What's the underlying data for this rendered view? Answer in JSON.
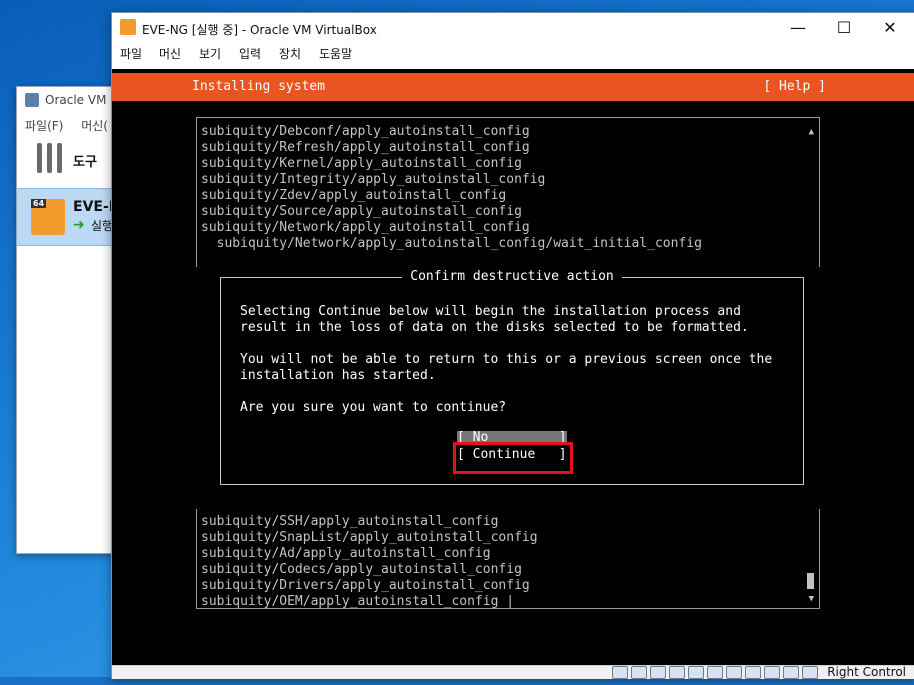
{
  "manager": {
    "title": "Oracle VM",
    "menu": [
      "파일(F)",
      "머신("
    ],
    "tools_label": "도구",
    "vm": {
      "name": "EVE-N",
      "state": "실행",
      "badge": "64"
    }
  },
  "window": {
    "title": "EVE-NG [실행 중] - Oracle VM VirtualBox",
    "controls": {
      "minimize": "—",
      "maximize": "☐",
      "close": "✕"
    },
    "menu": [
      "파일",
      "머신",
      "보기",
      "입력",
      "장치",
      "도움말"
    ],
    "status_host_key": "Right Control"
  },
  "installer": {
    "header": "Installing system",
    "help": "[ Help ]",
    "log_top": [
      "subiquity/Debconf/apply_autoinstall_config",
      "subiquity/Refresh/apply_autoinstall_config",
      "subiquity/Kernel/apply_autoinstall_config",
      "subiquity/Integrity/apply_autoinstall_config",
      "subiquity/Zdev/apply_autoinstall_config",
      "subiquity/Source/apply_autoinstall_config",
      "subiquity/Network/apply_autoinstall_config",
      "  subiquity/Network/apply_autoinstall_config/wait_initial_config"
    ],
    "log_bottom": [
      "subiquity/SSH/apply_autoinstall_config",
      "subiquity/SnapList/apply_autoinstall_config",
      "subiquity/Ad/apply_autoinstall_config",
      "subiquity/Codecs/apply_autoinstall_config",
      "subiquity/Drivers/apply_autoinstall_config",
      "subiquity/OEM/apply_autoinstall_config |"
    ],
    "dialog": {
      "title": "Confirm destructive action",
      "body": "Selecting Continue below will begin the installation process and\nresult in the loss of data on the disks selected to be formatted.\n\nYou will not be able to return to this or a previous screen once the\ninstallation has started.\n\nAre you sure you want to continue?",
      "no_button": "[ No         ]",
      "continue_button": "[ Continue   ]"
    }
  },
  "colors": {
    "accent": "#e95420",
    "highlight": "#e0141e"
  }
}
